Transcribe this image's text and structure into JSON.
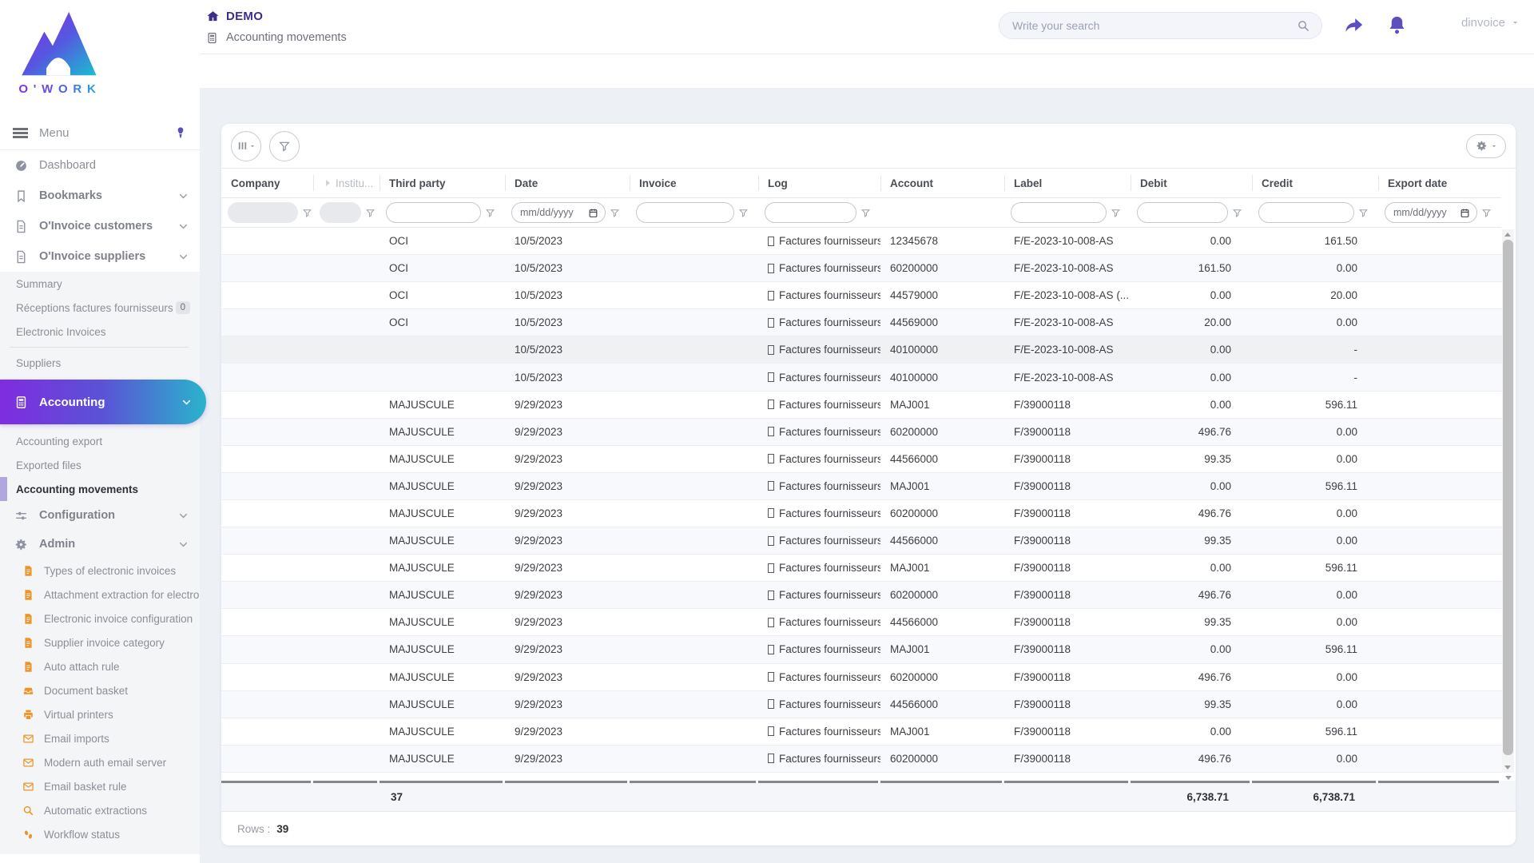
{
  "brand": {
    "logo_text": "O'WORK"
  },
  "topbar": {
    "app_title": "DEMO",
    "breadcrumb": "Accounting movements",
    "search_placeholder": "Write your search",
    "username": "dinvoice"
  },
  "sidebar": {
    "menu_label": "Menu",
    "items": [
      {
        "label": "Dashboard",
        "icon": "gauge",
        "type": "top",
        "section": false
      },
      {
        "label": "Bookmarks",
        "icon": "bookmark",
        "type": "top",
        "section": true,
        "chevron": true
      },
      {
        "label": "O'Invoice customers",
        "icon": "file",
        "type": "top",
        "section": true,
        "chevron": true
      },
      {
        "label": "O'Invoice suppliers",
        "icon": "file",
        "type": "top",
        "section": true,
        "chevron": true
      },
      {
        "label": "Summary",
        "type": "sub"
      },
      {
        "label": "Réceptions factures fournisseurs",
        "type": "sub",
        "badge": "0"
      },
      {
        "label": "Electronic Invoices",
        "type": "sub",
        "divider_after": true
      },
      {
        "label": "Suppliers",
        "type": "sub"
      },
      {
        "label": "Accounting",
        "icon": "calculator",
        "type": "gradient",
        "chevron": true
      },
      {
        "label": "Accounting export",
        "type": "sub"
      },
      {
        "label": "Exported files",
        "type": "sub"
      },
      {
        "label": "Accounting movements",
        "type": "sub",
        "active": true
      },
      {
        "label": "Configuration",
        "icon": "sliders",
        "type": "top2",
        "section": true,
        "chevron": true
      },
      {
        "label": "Admin",
        "icon": "gear",
        "type": "top2",
        "section": true,
        "chevron": true
      },
      {
        "label": "Types of electronic invoices",
        "icon": "file-solid",
        "type": "admin"
      },
      {
        "label": "Attachment extraction for electroni",
        "icon": "file-solid",
        "type": "admin"
      },
      {
        "label": "Electronic invoice configuration",
        "icon": "file-solid",
        "type": "admin"
      },
      {
        "label": "Supplier invoice category",
        "icon": "file-solid",
        "type": "admin"
      },
      {
        "label": "Auto attach rule",
        "icon": "file-solid",
        "type": "admin"
      },
      {
        "label": "Document basket",
        "icon": "inbox",
        "type": "admin"
      },
      {
        "label": "Virtual printers",
        "icon": "printer",
        "type": "admin"
      },
      {
        "label": "Email imports",
        "icon": "envelope",
        "type": "admin"
      },
      {
        "label": "Modern auth email server",
        "icon": "envelope",
        "type": "admin"
      },
      {
        "label": "Email basket rule",
        "icon": "envelope",
        "type": "admin"
      },
      {
        "label": "Automatic extractions",
        "icon": "magnifier",
        "type": "admin"
      },
      {
        "label": "Workflow status",
        "icon": "footprints",
        "type": "admin"
      }
    ]
  },
  "toolbar": {
    "icons": [
      "columns-icon",
      "filter-icon",
      "settings-icon"
    ]
  },
  "table": {
    "columns": [
      {
        "key": "company",
        "label": "Company",
        "filter": "disabled"
      },
      {
        "key": "institution",
        "label": "Institu...",
        "filter": "disabled",
        "muted": true,
        "pre_icon": "chevron-right"
      },
      {
        "key": "third_party",
        "label": "Third party",
        "filter": "text"
      },
      {
        "key": "date",
        "label": "Date",
        "filter": "date"
      },
      {
        "key": "invoice",
        "label": "Invoice",
        "filter": "text"
      },
      {
        "key": "log",
        "label": "Log",
        "filter": "text"
      },
      {
        "key": "account",
        "label": "Account",
        "filter": "none"
      },
      {
        "key": "label",
        "label": "Label",
        "filter": "text"
      },
      {
        "key": "debit",
        "label": "Debit",
        "filter": "text"
      },
      {
        "key": "credit",
        "label": "Credit",
        "filter": "text"
      },
      {
        "key": "export_date",
        "label": "Export date",
        "filter": "date"
      }
    ],
    "date_placeholder": "mm/dd/yyyy",
    "rows": [
      {
        "third_party": "OCI",
        "date": "10/5/2023",
        "log": "Factures fournisseurs",
        "account": "12345678",
        "label": "F/E-2023-10-008-AS",
        "debit": "0.00",
        "credit": "161.50"
      },
      {
        "third_party": "OCI",
        "date": "10/5/2023",
        "log": "Factures fournisseurs",
        "account": "60200000",
        "label": "F/E-2023-10-008-AS",
        "debit": "161.50",
        "credit": "0.00"
      },
      {
        "third_party": "OCI",
        "date": "10/5/2023",
        "log": "Factures fournisseurs",
        "account": "44579000",
        "label": "F/E-2023-10-008-AS (...",
        "debit": "0.00",
        "credit": "20.00"
      },
      {
        "third_party": "OCI",
        "date": "10/5/2023",
        "log": "Factures fournisseurs",
        "account": "44569000",
        "label": "F/E-2023-10-008-AS",
        "debit": "20.00",
        "credit": "0.00"
      },
      {
        "third_party": "",
        "date": "10/5/2023",
        "log": "Factures fournisseurs",
        "account": "40100000",
        "label": "F/E-2023-10-008-AS",
        "debit": "0.00",
        "credit": "-",
        "shade": true
      },
      {
        "third_party": "",
        "date": "10/5/2023",
        "log": "Factures fournisseurs",
        "account": "40100000",
        "label": "F/E-2023-10-008-AS",
        "debit": "0.00",
        "credit": "-"
      },
      {
        "third_party": "MAJUSCULE",
        "date": "9/29/2023",
        "log": "Factures fournisseurs",
        "account": "MAJ001",
        "label": "F/39000118",
        "debit": "0.00",
        "credit": "596.11"
      },
      {
        "third_party": "MAJUSCULE",
        "date": "9/29/2023",
        "log": "Factures fournisseurs",
        "account": "60200000",
        "label": "F/39000118",
        "debit": "496.76",
        "credit": "0.00"
      },
      {
        "third_party": "MAJUSCULE",
        "date": "9/29/2023",
        "log": "Factures fournisseurs",
        "account": "44566000",
        "label": "F/39000118",
        "debit": "99.35",
        "credit": "0.00"
      },
      {
        "third_party": "MAJUSCULE",
        "date": "9/29/2023",
        "log": "Factures fournisseurs",
        "account": "MAJ001",
        "label": "F/39000118",
        "debit": "0.00",
        "credit": "596.11"
      },
      {
        "third_party": "MAJUSCULE",
        "date": "9/29/2023",
        "log": "Factures fournisseurs",
        "account": "60200000",
        "label": "F/39000118",
        "debit": "496.76",
        "credit": "0.00"
      },
      {
        "third_party": "MAJUSCULE",
        "date": "9/29/2023",
        "log": "Factures fournisseurs",
        "account": "44566000",
        "label": "F/39000118",
        "debit": "99.35",
        "credit": "0.00"
      },
      {
        "third_party": "MAJUSCULE",
        "date": "9/29/2023",
        "log": "Factures fournisseurs",
        "account": "MAJ001",
        "label": "F/39000118",
        "debit": "0.00",
        "credit": "596.11"
      },
      {
        "third_party": "MAJUSCULE",
        "date": "9/29/2023",
        "log": "Factures fournisseurs",
        "account": "60200000",
        "label": "F/39000118",
        "debit": "496.76",
        "credit": "0.00"
      },
      {
        "third_party": "MAJUSCULE",
        "date": "9/29/2023",
        "log": "Factures fournisseurs",
        "account": "44566000",
        "label": "F/39000118",
        "debit": "99.35",
        "credit": "0.00"
      },
      {
        "third_party": "MAJUSCULE",
        "date": "9/29/2023",
        "log": "Factures fournisseurs",
        "account": "MAJ001",
        "label": "F/39000118",
        "debit": "0.00",
        "credit": "596.11"
      },
      {
        "third_party": "MAJUSCULE",
        "date": "9/29/2023",
        "log": "Factures fournisseurs",
        "account": "60200000",
        "label": "F/39000118",
        "debit": "496.76",
        "credit": "0.00"
      },
      {
        "third_party": "MAJUSCULE",
        "date": "9/29/2023",
        "log": "Factures fournisseurs",
        "account": "44566000",
        "label": "F/39000118",
        "debit": "99.35",
        "credit": "0.00"
      },
      {
        "third_party": "MAJUSCULE",
        "date": "9/29/2023",
        "log": "Factures fournisseurs",
        "account": "MAJ001",
        "label": "F/39000118",
        "debit": "0.00",
        "credit": "596.11"
      },
      {
        "third_party": "MAJUSCULE",
        "date": "9/29/2023",
        "log": "Factures fournisseurs",
        "account": "60200000",
        "label": "F/39000118",
        "debit": "496.76",
        "credit": "0.00"
      }
    ],
    "totals": {
      "third_party": "37",
      "debit": "6,738.71",
      "credit": "6,738.71"
    },
    "footer": {
      "rows_label": "Rows :",
      "rows_count": "39"
    }
  },
  "colors": {
    "accent_purple": "#5b4fc0",
    "title_indigo": "#3e2d90",
    "gradient_start": "#7f2ce0",
    "gradient_end": "#2ab3cc",
    "admin_icon_orange": "#ef9426",
    "page_background": "#edf0f5"
  }
}
